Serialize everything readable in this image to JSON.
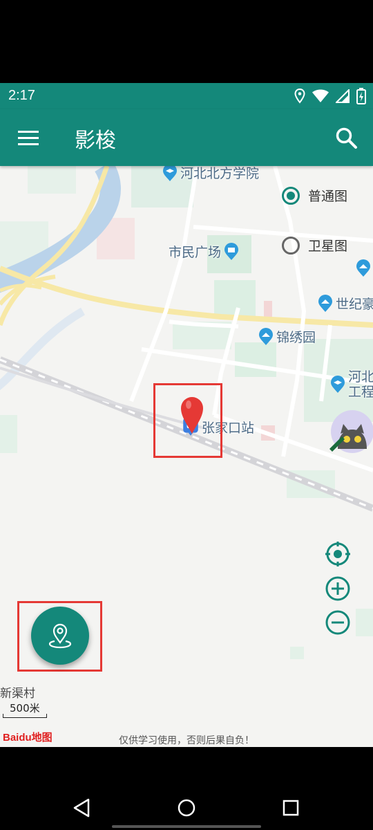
{
  "status_bar": {
    "time": "2:17",
    "icons": [
      "location-icon",
      "wifi-icon",
      "signal-icon",
      "battery-charging-icon"
    ]
  },
  "app_bar": {
    "title": "影梭",
    "menu_icon": "hamburger-menu-icon",
    "search_icon": "search-icon"
  },
  "map": {
    "pois": [
      {
        "id": "hebei-north-univ",
        "label": "河北北方学院",
        "icon": "school-pin-icon"
      },
      {
        "id": "citizen-square",
        "label": "市民广场",
        "icon": "landmark-pin-icon"
      },
      {
        "id": "shiji",
        "label": "世纪豪",
        "icon": "building-pin-icon"
      },
      {
        "id": "jinxiuyuan",
        "label": "锦绣园",
        "icon": "building-pin-icon"
      },
      {
        "id": "hebei-eng",
        "label1": "河北",
        "label2": "工程",
        "icon": "school-pin-icon"
      },
      {
        "id": "zhangjiakou-station",
        "label": "张家口站",
        "icon": "train-station-icon"
      }
    ],
    "village_label": "新渠村",
    "scale_label": "500米",
    "logo": "Baidu地图",
    "disclaimer": "仅供学习使用，否则后果自负！"
  },
  "map_types": [
    {
      "label": "普通图",
      "selected": true
    },
    {
      "label": "卫星图",
      "selected": false
    }
  ],
  "controls": [
    "locate-icon",
    "zoom-in-icon",
    "zoom-out-icon"
  ],
  "fab": {
    "icon": "location-pin-icon"
  },
  "colors": {
    "primary": "#14887a",
    "marker": "#e53935",
    "highlight": "#e53935"
  }
}
